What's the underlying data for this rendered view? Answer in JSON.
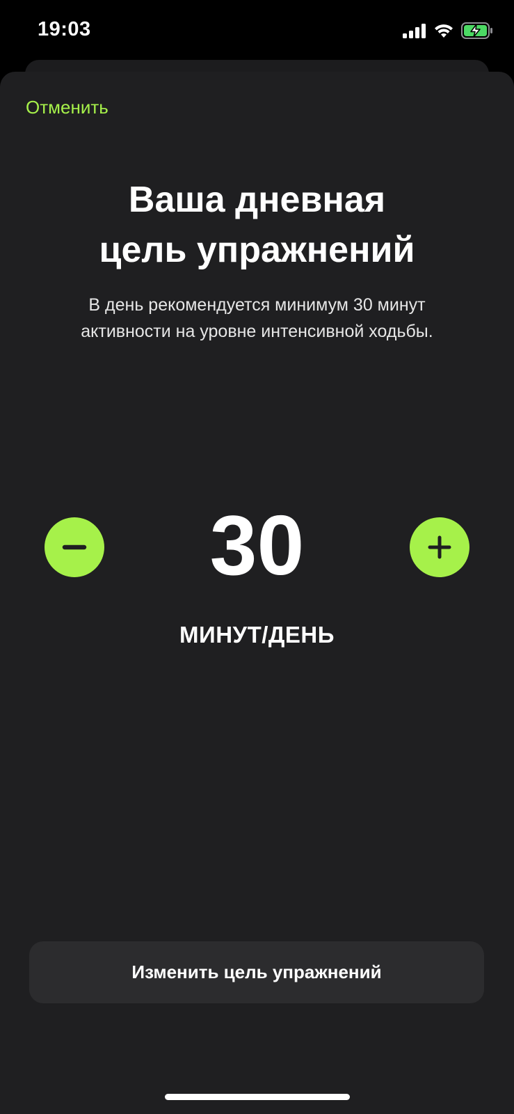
{
  "status_bar": {
    "time": "19:03",
    "icons": [
      "signal-icon",
      "wifi-icon",
      "battery-charging-icon"
    ]
  },
  "sheet": {
    "cancel_label": "Отменить",
    "title_line1": "Ваша дневная",
    "title_line2": "цель упражнений",
    "subtitle_line1": "В день рекомендуется минимум 30 минут",
    "subtitle_line2": "активности на уровне интенсивной ходьбы.",
    "value": "30",
    "unit": "МИНУТ/ДЕНЬ",
    "change_button_label": "Изменить цель упражнений"
  },
  "colors": {
    "accent": "#a6f14a",
    "sheet_background": "#1f1f21",
    "button_background": "#2c2c2e",
    "battery_fill": "#4cd964"
  }
}
